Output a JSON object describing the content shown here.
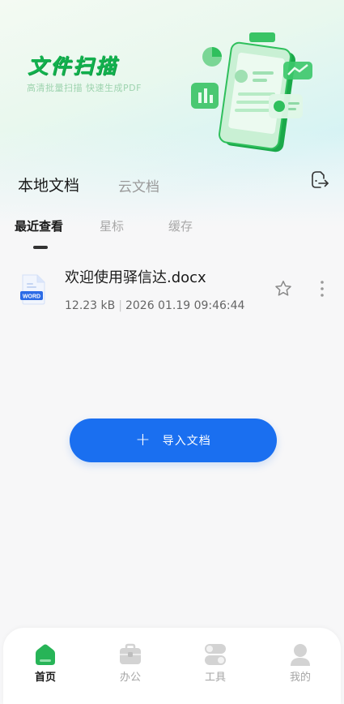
{
  "hero": {
    "title": "文件扫描",
    "subtitle": "高清批量扫描 快速生成PDF"
  },
  "doc_tabs": [
    {
      "label": "本地文档",
      "active": true
    },
    {
      "label": "云文档",
      "active": false
    }
  ],
  "sub_tabs": [
    {
      "label": "最近查看",
      "active": true
    },
    {
      "label": "星标",
      "active": false
    },
    {
      "label": "缓存",
      "active": false
    }
  ],
  "files": [
    {
      "name": "欢迎使用驿信达.docx",
      "size": "12.23 kB",
      "separator": "|",
      "date": "2026 01.19 09:46:44",
      "type_badge": "WORD",
      "icon": "word-file-icon"
    }
  ],
  "import_button": {
    "icon": "plus-icon",
    "label": "导入文档"
  },
  "bottom_nav": [
    {
      "label": "首页",
      "icon": "home-icon",
      "active": true
    },
    {
      "label": "办公",
      "icon": "briefcase-icon",
      "active": false
    },
    {
      "label": "工具",
      "icon": "toggles-icon",
      "active": false
    },
    {
      "label": "我的",
      "icon": "user-icon",
      "active": false
    }
  ],
  "colors": {
    "brand_green": "#12b14e",
    "primary_blue": "#1a6ff0",
    "word_blue": "#2b6be6"
  }
}
